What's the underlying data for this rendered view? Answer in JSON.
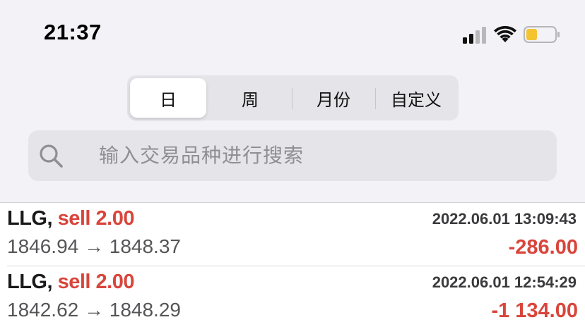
{
  "status_bar": {
    "time": "21:37",
    "battery_color": "#f4c430"
  },
  "segments": [
    {
      "label": "日",
      "active": true
    },
    {
      "label": "周",
      "active": false
    },
    {
      "label": "月份",
      "active": false
    },
    {
      "label": "自定义",
      "active": false
    }
  ],
  "search": {
    "placeholder": "输入交易品种进行搜索",
    "value": ""
  },
  "trades": [
    {
      "symbol": "LLG,",
      "side": "sell 2.00",
      "timestamp": "2022.06.01 13:09:43",
      "prices": "1846.94 → 1848.37",
      "profit": "-286.00"
    },
    {
      "symbol": "LLG,",
      "side": "sell 2.00",
      "timestamp": "2022.06.01 12:54:29",
      "prices": "1842.62 → 1848.29",
      "profit": "-1 134.00"
    }
  ],
  "colors": {
    "loss_red": "#d9453b",
    "background": "#f2f2f7"
  }
}
